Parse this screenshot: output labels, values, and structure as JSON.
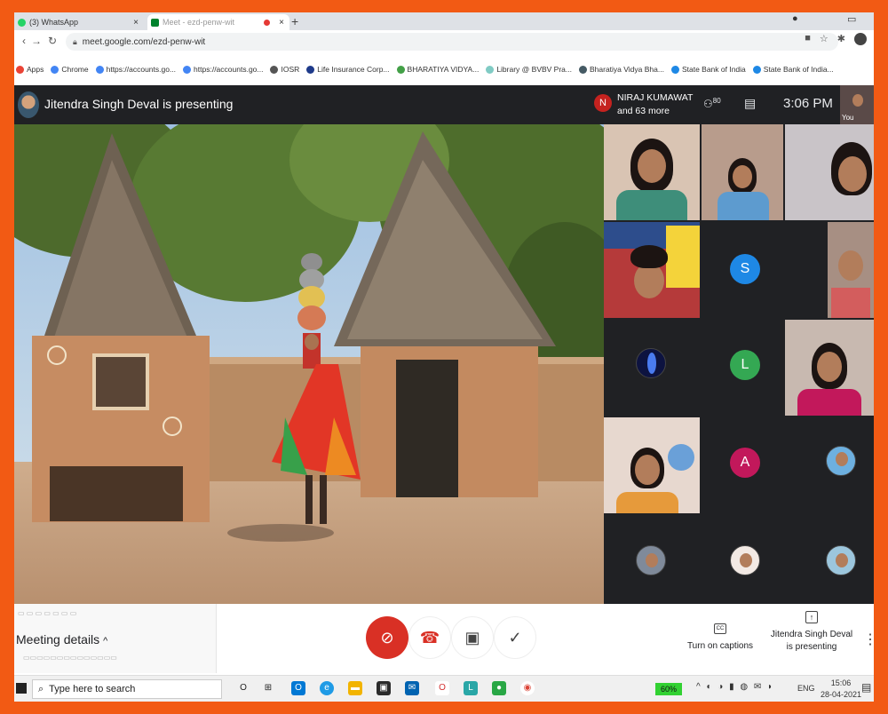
{
  "browser": {
    "tabs": [
      {
        "label": "(3) WhatsApp",
        "close": "×"
      },
      {
        "label": "Meet - ezd-penw-wit",
        "close": "×"
      }
    ],
    "new_tab": "+",
    "url": "meet.google.com/ezd-penw-wit",
    "bookmarks": [
      {
        "label": "Apps",
        "color": "#ea4335"
      },
      {
        "label": "Chrome",
        "color": "#4285f4"
      },
      {
        "label": "https://accounts.go...",
        "color": "#4285f4"
      },
      {
        "label": "https://accounts.go...",
        "color": "#4285f4"
      },
      {
        "label": "IOSR",
        "color": "#555555"
      },
      {
        "label": "Life Insurance Corp...",
        "color": "#1e3a8a"
      },
      {
        "label": "BHARATIYA VIDYA...",
        "color": "#43a047"
      },
      {
        "label": "Library @ BVBV Pra...",
        "color": "#80cbc4"
      },
      {
        "label": "Bharatiya Vidya Bha...",
        "color": "#455a64"
      },
      {
        "label": "State Bank of India",
        "color": "#1e88e5"
      },
      {
        "label": "State Bank of India...",
        "color": "#1e88e5"
      }
    ]
  },
  "meet": {
    "presenting_banner": "Jitendra Singh Deval is presenting",
    "participant_name": "NIRAJ KUMAWAT",
    "participant_more": "and 63 more",
    "participant_initial": "N",
    "people_count": "80",
    "time": "3:06 PM",
    "self_label": "You",
    "gallery_letters": [
      {
        "letter": "S",
        "color": "#1e88e5"
      },
      {
        "letter": "L",
        "color": "#34a853"
      },
      {
        "letter": "A",
        "color": "#c2185b"
      }
    ],
    "meeting_details": "Meeting details",
    "controls": {
      "captions": "Turn on captions",
      "presenting_line1": "Jitendra Singh Deval",
      "presenting_line2": "is presenting"
    }
  },
  "taskbar": {
    "search_placeholder": "Type here to search",
    "battery": "60%",
    "language": "ENG",
    "clock_time": "15:06",
    "clock_date": "28-04-2021"
  },
  "colors": {
    "frame_border": "#f25a14",
    "meet_dark": "#202124",
    "end_call_red": "#d93025"
  }
}
